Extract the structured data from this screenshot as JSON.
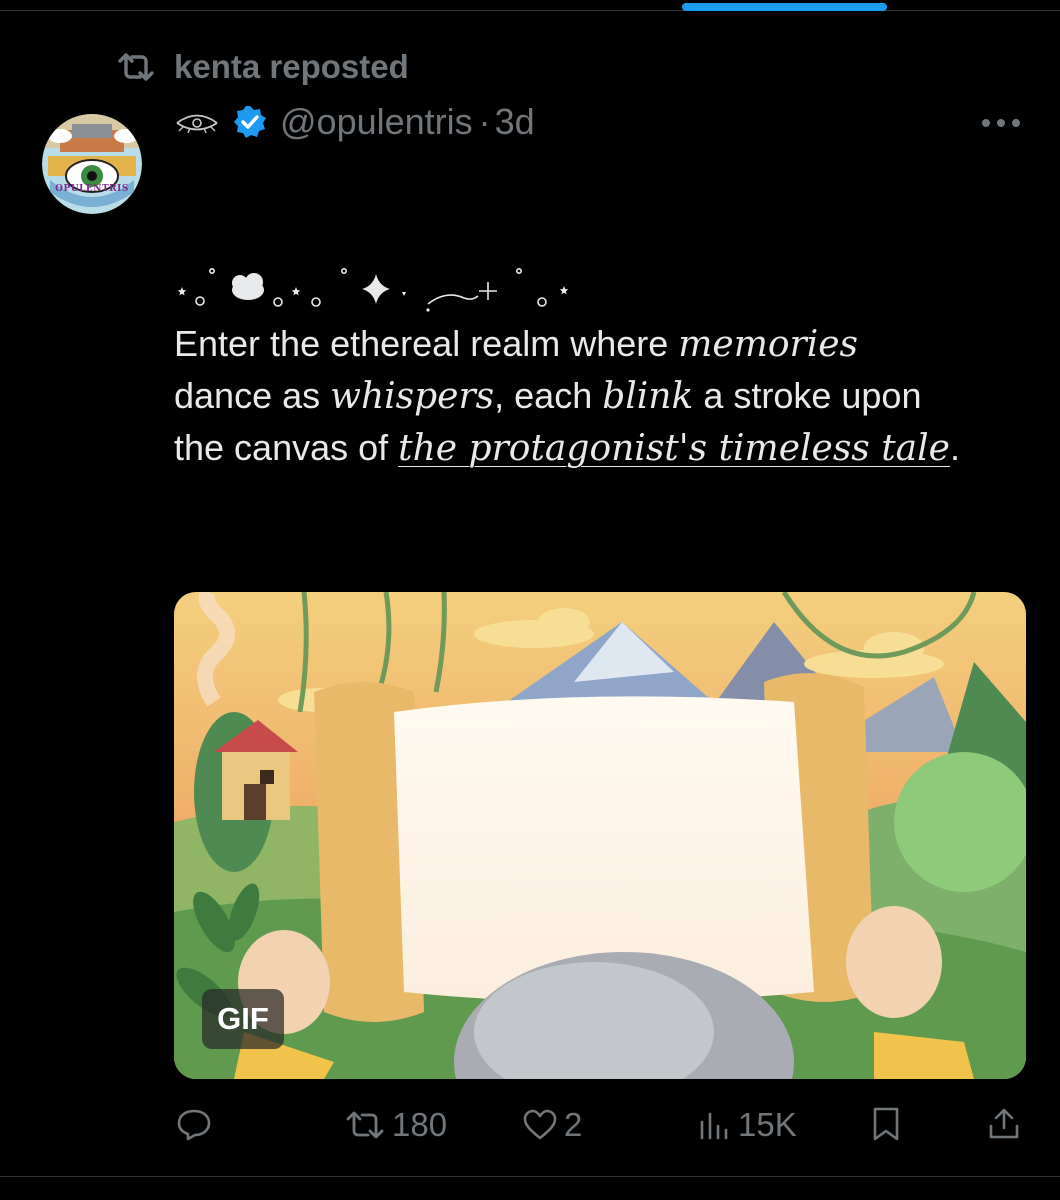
{
  "repost": {
    "label": "kenta reposted",
    "icon": "repost-icon"
  },
  "author": {
    "avatar_text": "OPULENTRIS",
    "handle": "@opulentris",
    "separator": "·",
    "time": "3d",
    "verified_color": "#1d9bf0"
  },
  "tweet": {
    "line1_a": "Enter  the  ethereal  realm  where ",
    "line1_b": "memories",
    "line2_a": "dance as ",
    "line2_b": "whispers",
    "line2_c": ", each ",
    "line2_d": "blink",
    "line2_e": " a stroke upon",
    "line3_a": "the canvas  of ",
    "line3_b": "  the protagonist's timeless tale",
    "line3_c": "."
  },
  "media": {
    "badge": "GIF"
  },
  "actions": {
    "reply_count": "",
    "repost_count": "180",
    "like_count": "2",
    "views_count": "15K"
  },
  "colors": {
    "accent": "#1d9bf0",
    "muted": "#71767b",
    "text": "#e7e9ea"
  }
}
